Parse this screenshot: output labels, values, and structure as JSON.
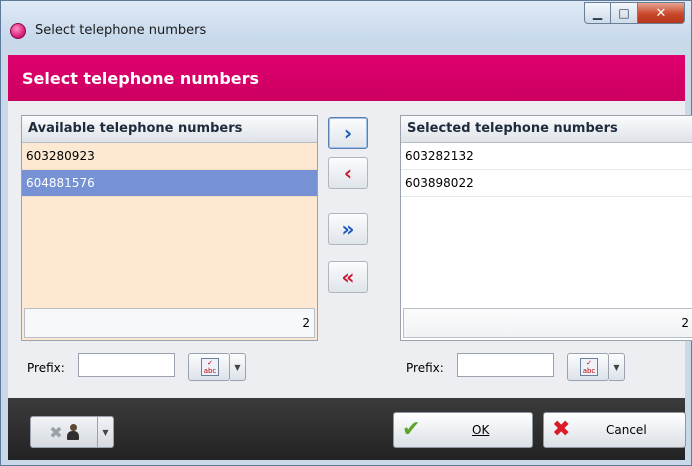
{
  "window": {
    "title": "Select telephone numbers"
  },
  "header": {
    "title": "Select telephone numbers"
  },
  "available": {
    "column_header": "Available telephone numbers",
    "items": [
      "603280923",
      "604881576"
    ],
    "selected_index": 1,
    "count": "2"
  },
  "selected": {
    "column_header": "Selected telephone numbers",
    "items": [
      "603282132",
      "603898022"
    ],
    "count": "2"
  },
  "move_buttons": {
    "add_one": "›",
    "remove_one": "‹",
    "add_all": "»",
    "remove_all": "«"
  },
  "prefix": {
    "label": "Prefix:",
    "left_value": "",
    "right_value": ""
  },
  "footer": {
    "ok_label": "OK",
    "cancel_label": "Cancel"
  },
  "colors": {
    "accent": "#d8006a",
    "selection": "#7692d4",
    "available_bg": "#fde9d1"
  },
  "icons": [
    "app-icon",
    "minimize-icon",
    "maximize-icon",
    "close-icon",
    "spellcheck-icon",
    "chevron-down-icon",
    "remove-user-icon",
    "check-icon",
    "cross-icon"
  ]
}
